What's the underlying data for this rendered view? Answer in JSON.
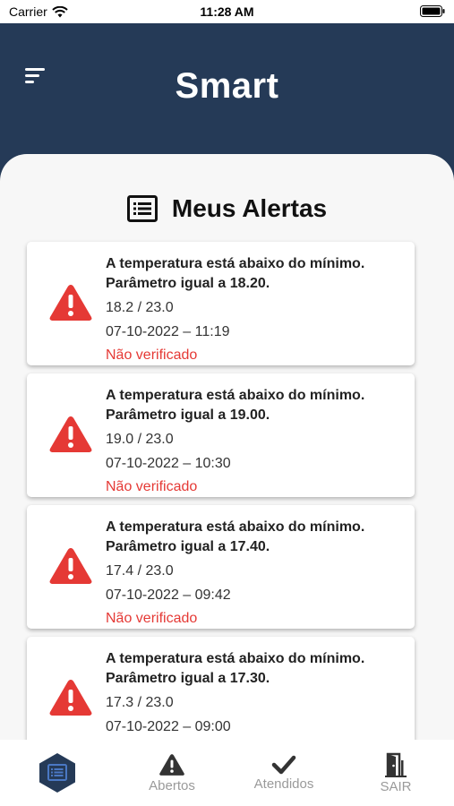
{
  "status_bar": {
    "carrier": "Carrier",
    "time": "11:28 AM"
  },
  "header": {
    "title": "Smart",
    "menu_icon": "menu-icon"
  },
  "section": {
    "title": "Meus Alertas",
    "icon": "list-icon"
  },
  "alerts": [
    {
      "title": "A temperatura está abaixo do mínimo. Parâmetro igual a 18.20.",
      "values": "18.2 / 23.0",
      "datetime": "07-10-2022 – 11:19",
      "status": "Não verificado"
    },
    {
      "title": "A temperatura está abaixo do mínimo. Parâmetro igual a 19.00.",
      "values": "19.0 / 23.0",
      "datetime": "07-10-2022 – 10:30",
      "status": "Não verificado"
    },
    {
      "title": "A temperatura está abaixo do mínimo. Parâmetro igual a 17.40.",
      "values": "17.4 / 23.0",
      "datetime": "07-10-2022 – 09:42",
      "status": "Não verificado"
    },
    {
      "title": "A temperatura está abaixo do mínimo. Parâmetro igual a 17.30.",
      "values": "17.3 / 23.0",
      "datetime": "07-10-2022 – 09:00",
      "status": ""
    }
  ],
  "tabs": {
    "open": "Abertos",
    "done": "Atendidos",
    "exit": "SAIR"
  },
  "colors": {
    "header_bg": "#253a57",
    "alert_icon": "#e53935",
    "status_text": "#e53935",
    "tab_inactive": "#9a9a9a"
  }
}
